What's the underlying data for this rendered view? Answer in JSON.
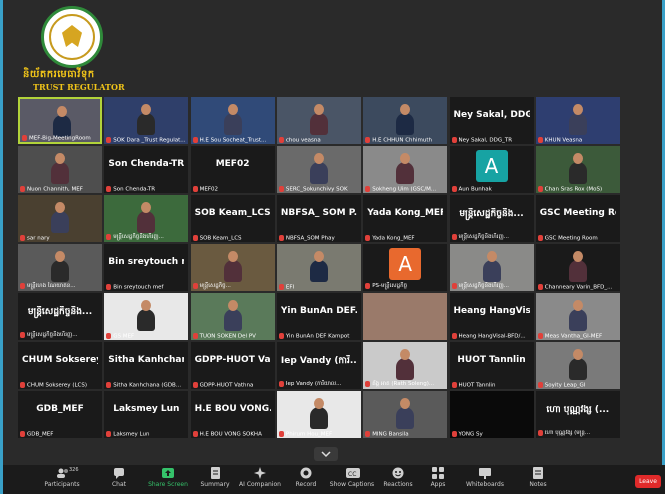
{
  "org": {
    "name_km": "និយ័តករមេធាវីទុក",
    "name_en": "TRUST REGULATOR",
    "logo_ring_text": "TRUST REGULATOR"
  },
  "tiles": [
    {
      "label": "MEF-Big-MeetingRoom",
      "big": ""
    },
    {
      "label": "SOK Dara _Trust Regulat...",
      "big": ""
    },
    {
      "label": "H.E Sou Socheat_Trust...",
      "big": ""
    },
    {
      "label": "chou veasna",
      "big": ""
    },
    {
      "label": "H.E CHHUN Chhimuth",
      "big": ""
    },
    {
      "label": "Ney Sakal, DDG_TR",
      "big": "Ney Sakal, DDG..."
    },
    {
      "label": "KHUN Veasna",
      "big": ""
    },
    {
      "label": "Nuon Channith, MEF",
      "big": ""
    },
    {
      "label": "Son Chenda-TR",
      "big": "Son Chenda-TR"
    },
    {
      "label": "MEF02",
      "big": "MEF02"
    },
    {
      "label": "SERC_Sokunchivy SOK",
      "big": ""
    },
    {
      "label": "Sokheng Uim (GSC/M...",
      "big": ""
    },
    {
      "label": "Aun Bunhak",
      "big": ""
    },
    {
      "label": "Chan Sras Rox (MoS)",
      "big": ""
    },
    {
      "label": "sar nary",
      "big": ""
    },
    {
      "label": "មន្ត្រីសេដ្ឋកិច្ចនិងហិរញ្ញ...",
      "big": ""
    },
    {
      "label": "SOB Keam_LCS",
      "big": "SOB Keam_LCS"
    },
    {
      "label": "NBFSA_SOM Phay",
      "big": "NBFSA_ SOM P..."
    },
    {
      "label": "Yada Kong_MEF",
      "big": "Yada Kong_MEF"
    },
    {
      "label": "មន្ត្រីសេដ្ឋកិច្ចនិងហិរញ្ញ...",
      "big": "មន្ត្រីសេដ្ឋកិច្ចនិង..."
    },
    {
      "label": "GSC Meeting Room",
      "big": "GSC Meeting Ro..."
    },
    {
      "label": "មន្ត្រីហេង ណៃយាតន...",
      "big": ""
    },
    {
      "label": "Bin sreytouch mef",
      "big": "Bin sreytouch m..."
    },
    {
      "label": "មន្ត្រីសេដ្ឋកិច្ច...",
      "big": ""
    },
    {
      "label": "EFI",
      "big": ""
    },
    {
      "label": "PS-មន្ត្រីសេដ្ឋកិច្ច",
      "big": ""
    },
    {
      "label": "មន្ត្រីសេដ្ឋកិច្ចនិងហិរញ្ញ...",
      "big": ""
    },
    {
      "label": "Channeary Varin_BFD_...",
      "big": ""
    },
    {
      "label": "មន្ត្រីសេដ្ឋកិច្ចនិងហិរញ្ញ...",
      "big": "មន្ត្រីសេដ្ឋកិច្ចនិង..."
    },
    {
      "label": "GS MEF",
      "big": ""
    },
    {
      "label": "TUON SOKEN Del PV",
      "big": ""
    },
    {
      "label": "Yin BunAn DEF Kampot",
      "big": "Yin BunAn DEF..."
    },
    {
      "label": "",
      "big": ""
    },
    {
      "label": "Heang HangVisal-BFD/...",
      "big": "Heang HangVis..."
    },
    {
      "label": "Meas Vantha_GI-MEF",
      "big": ""
    },
    {
      "label": "CHUM Sokserey (LCS)",
      "big": "CHUM Sokserey..."
    },
    {
      "label": "Sitha Kanhchana (GDB...",
      "big": "Sitha Kanhchan..."
    },
    {
      "label": "GDPP-HUOT Vathna",
      "big": "GDPP-HUOT Va..."
    },
    {
      "label": "Iep Vandy (ការិយាល...",
      "big": "Iep Vandy (ការិ..."
    },
    {
      "label": "គ័ង្គ អាត (Rath Soleng)...",
      "big": ""
    },
    {
      "label": "HUOT Tannlin",
      "big": "HUOT Tannlin"
    },
    {
      "label": "Soyity Leap_GI",
      "big": ""
    },
    {
      "label": "GDB_MEF",
      "big": "GDB_MEF"
    },
    {
      "label": "Laksmey Lun",
      "big": "Laksmey Lun"
    },
    {
      "label": "H.E BOU VONG SOKHA",
      "big": "H.E BOU VONG..."
    },
    {
      "label": "Phirum Hou_MEF",
      "big": ""
    },
    {
      "label": "MING Bansila",
      "big": ""
    },
    {
      "label": "YONG Sy",
      "big": ""
    },
    {
      "label": "ហោ បុណ្ណវង្ស (មន្ត្រ...",
      "big": "ហោ បុណ្ណវង្ស (..."
    }
  ],
  "toolbar": {
    "participants_label": "Participants",
    "participants_count": "326",
    "chat_label": "Chat",
    "share_label": "Share Screen",
    "summary_label": "Summary",
    "ai_label": "AI Companion",
    "record_label": "Record",
    "captions_label": "Show Captions",
    "reactions_label": "Reactions",
    "apps_label": "Apps",
    "whiteboards_label": "Whiteboards",
    "notes_label": "Notes",
    "leave_label": "Leave"
  },
  "colors": {
    "accent_green": "#35c26a",
    "leave_red": "#e02a2a",
    "active_border": "#b2d33a",
    "org_text": "#f0c419"
  }
}
